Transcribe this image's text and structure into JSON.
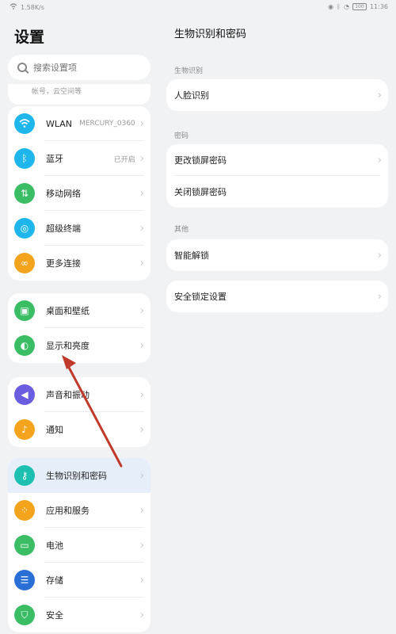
{
  "status": {
    "network": "1.58K/s",
    "time": "11:36",
    "battery": "100"
  },
  "sidebar": {
    "title": "设置",
    "search_placeholder": "搜索设置项",
    "account_sub": "帐号，云空间等",
    "group1": [
      {
        "label": "WLAN",
        "value": "MERCURY_0360",
        "icon": "wifi-icon",
        "color": "#1fb6ec"
      },
      {
        "label": "蓝牙",
        "value": "已开启",
        "icon": "bluetooth-icon",
        "color": "#1fb6ec"
      },
      {
        "label": "移动网络",
        "value": "",
        "icon": "signal-icon",
        "color": "#3bbd66"
      },
      {
        "label": "超级终端",
        "value": "",
        "icon": "super-device-icon",
        "color": "#1fb6ec"
      },
      {
        "label": "更多连接",
        "value": "",
        "icon": "link-icon",
        "color": "#f4a31c"
      }
    ],
    "group2": [
      {
        "label": "桌面和壁纸",
        "icon": "image-icon",
        "color": "#3bbd66"
      },
      {
        "label": "显示和亮度",
        "icon": "brightness-icon",
        "color": "#3bbd66"
      }
    ],
    "group3": [
      {
        "label": "声音和振动",
        "icon": "volume-icon",
        "color": "#6a5de0"
      },
      {
        "label": "通知",
        "icon": "bell-icon",
        "color": "#f4a31c"
      }
    ],
    "group4": [
      {
        "label": "生物识别和密码",
        "icon": "key-icon",
        "color": "#1cbfb0",
        "active": true
      },
      {
        "label": "应用和服务",
        "icon": "apps-icon",
        "color": "#f4a31c"
      },
      {
        "label": "电池",
        "icon": "battery-icon",
        "color": "#3bbd66"
      },
      {
        "label": "存储",
        "icon": "storage-icon",
        "color": "#2a6fd6"
      },
      {
        "label": "安全",
        "icon": "shield-icon",
        "color": "#3bbd66"
      }
    ]
  },
  "main": {
    "title": "生物识别和密码",
    "sections": [
      {
        "label": "生物识别",
        "items": [
          "人脸识别"
        ]
      },
      {
        "label": "密码",
        "items": [
          "更改锁屏密码",
          "关闭锁屏密码"
        ]
      },
      {
        "label": "其他",
        "items": [
          "智能解锁"
        ]
      },
      {
        "label": "",
        "items": [
          "安全锁定设置"
        ]
      }
    ]
  }
}
